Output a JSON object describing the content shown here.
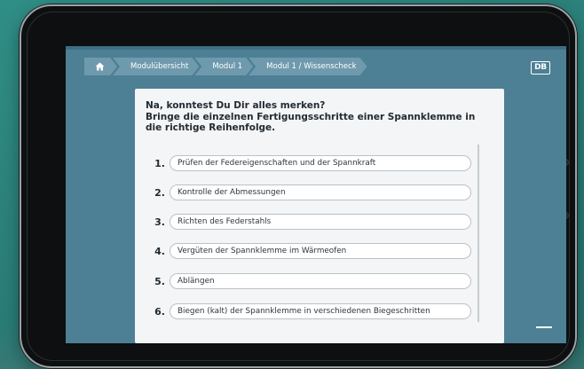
{
  "breadcrumb": {
    "items": [
      "Modulübersicht",
      "Modul 1",
      "Modul 1 / Wissenscheck"
    ]
  },
  "brand": {
    "logo_text": "DB"
  },
  "quiz": {
    "question_line1": "Na, konntest Du Dir alles merken?",
    "question_line2": "Bringe die einzelnen Fertigungsschritte einer Spannklemme in die richtige Reihenfolge.",
    "items": [
      {
        "number": "1.",
        "label": "Prüfen der Federeigenschaften und der Spannkraft"
      },
      {
        "number": "2.",
        "label": "Kontrolle der Abmessungen"
      },
      {
        "number": "3.",
        "label": "Richten des Federstahls"
      },
      {
        "number": "4.",
        "label": "Vergüten der Spannklemme im Wärmeofen"
      },
      {
        "number": "5.",
        "label": "Ablängen"
      },
      {
        "number": "6.",
        "label": "Biegen (kalt) der Spannklemme in verschiedenen Biegeschritten"
      }
    ]
  },
  "colors": {
    "background_teal": "#2f8e86",
    "screen_blue": "#4d7f95",
    "breadcrumb_blue": "#6f9aad",
    "card": "#f3f5f6"
  },
  "icons": [
    "home-icon",
    "menu-icon"
  ]
}
